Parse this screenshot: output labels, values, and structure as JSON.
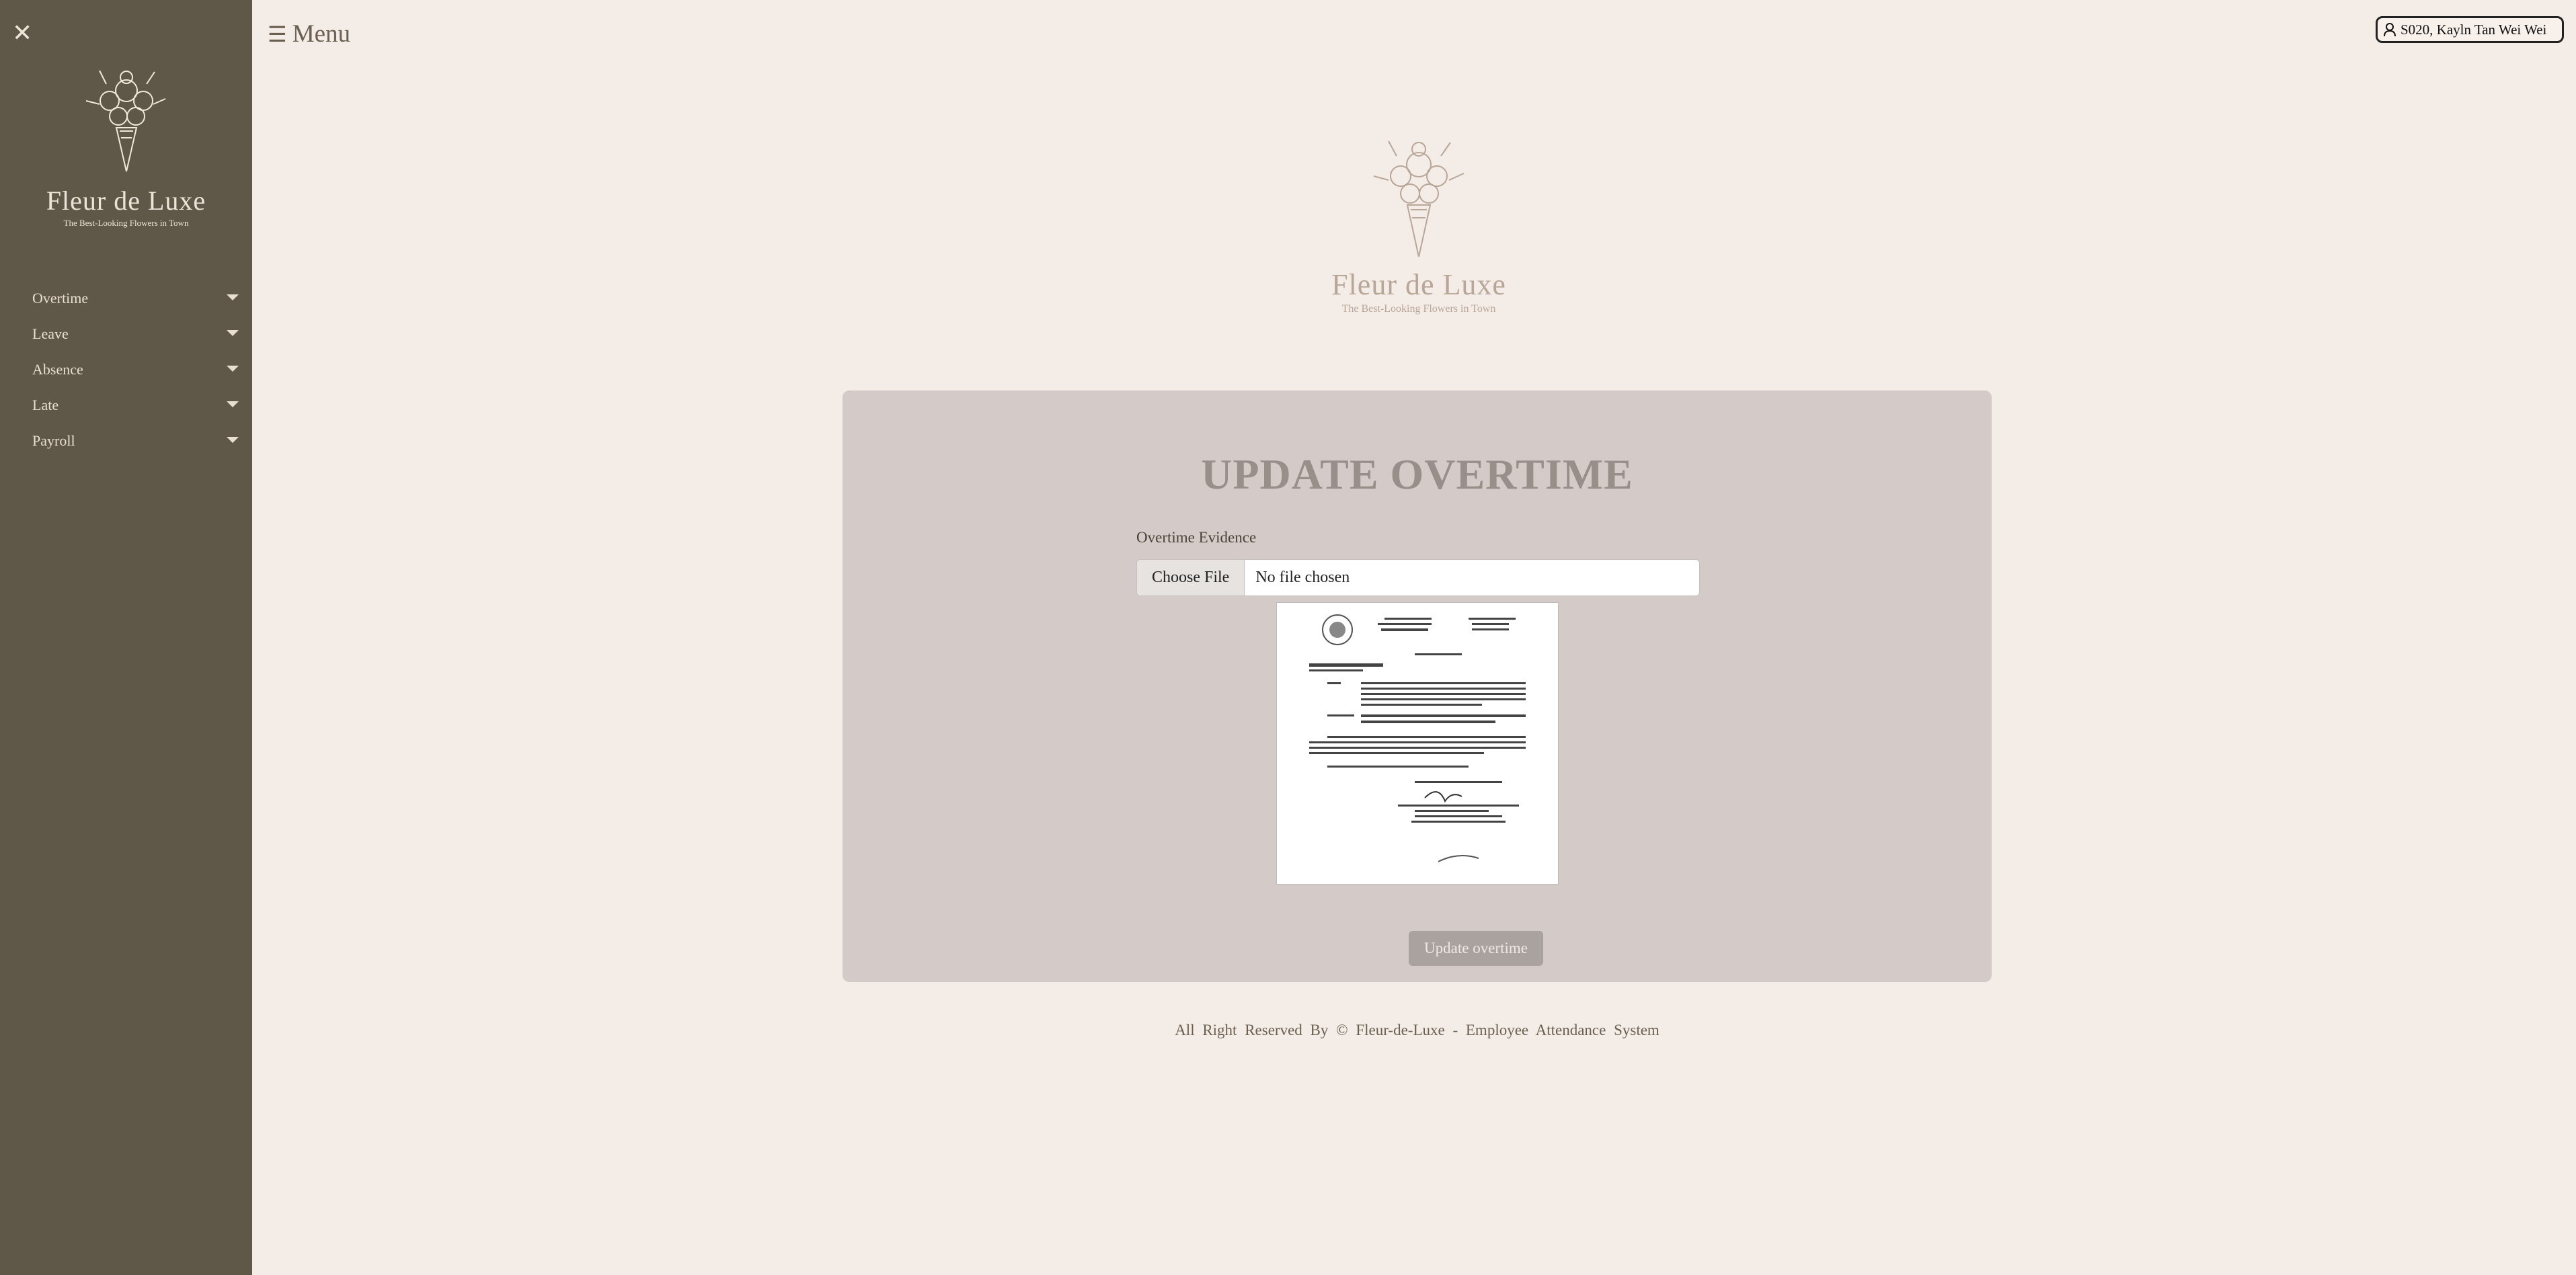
{
  "sidebar": {
    "close_icon": "close-icon",
    "brand": "Fleur de Luxe",
    "tagline": "The Best-Looking Flowers in Town",
    "items": [
      {
        "label": "Overtime"
      },
      {
        "label": "Leave"
      },
      {
        "label": "Absence"
      },
      {
        "label": "Late"
      },
      {
        "label": "Payroll"
      }
    ]
  },
  "header": {
    "menu_label": "Menu",
    "menu_icon": "hamburger-icon",
    "user_label": "S020, Kayln Tan Wei Wei",
    "user_icon": "user-icon"
  },
  "logo": {
    "brand": "Fleur de Luxe",
    "tagline": "The Best-Looking Flowers in Town"
  },
  "form": {
    "title": "UPDATE OVERTIME",
    "evidence_label": "Overtime Evidence",
    "choose_file_label": "Choose File",
    "file_status": "No file chosen",
    "submit_label": "Update overtime"
  },
  "footer": {
    "text": "All Right Reserved By © Fleur-de-Luxe - Employee Attendance System"
  },
  "colors": {
    "sidebar_bg": "#5f5747",
    "page_bg": "#f4ece7",
    "panel_bg": "#d4cbc8",
    "button_bg": "#a9a29f"
  }
}
